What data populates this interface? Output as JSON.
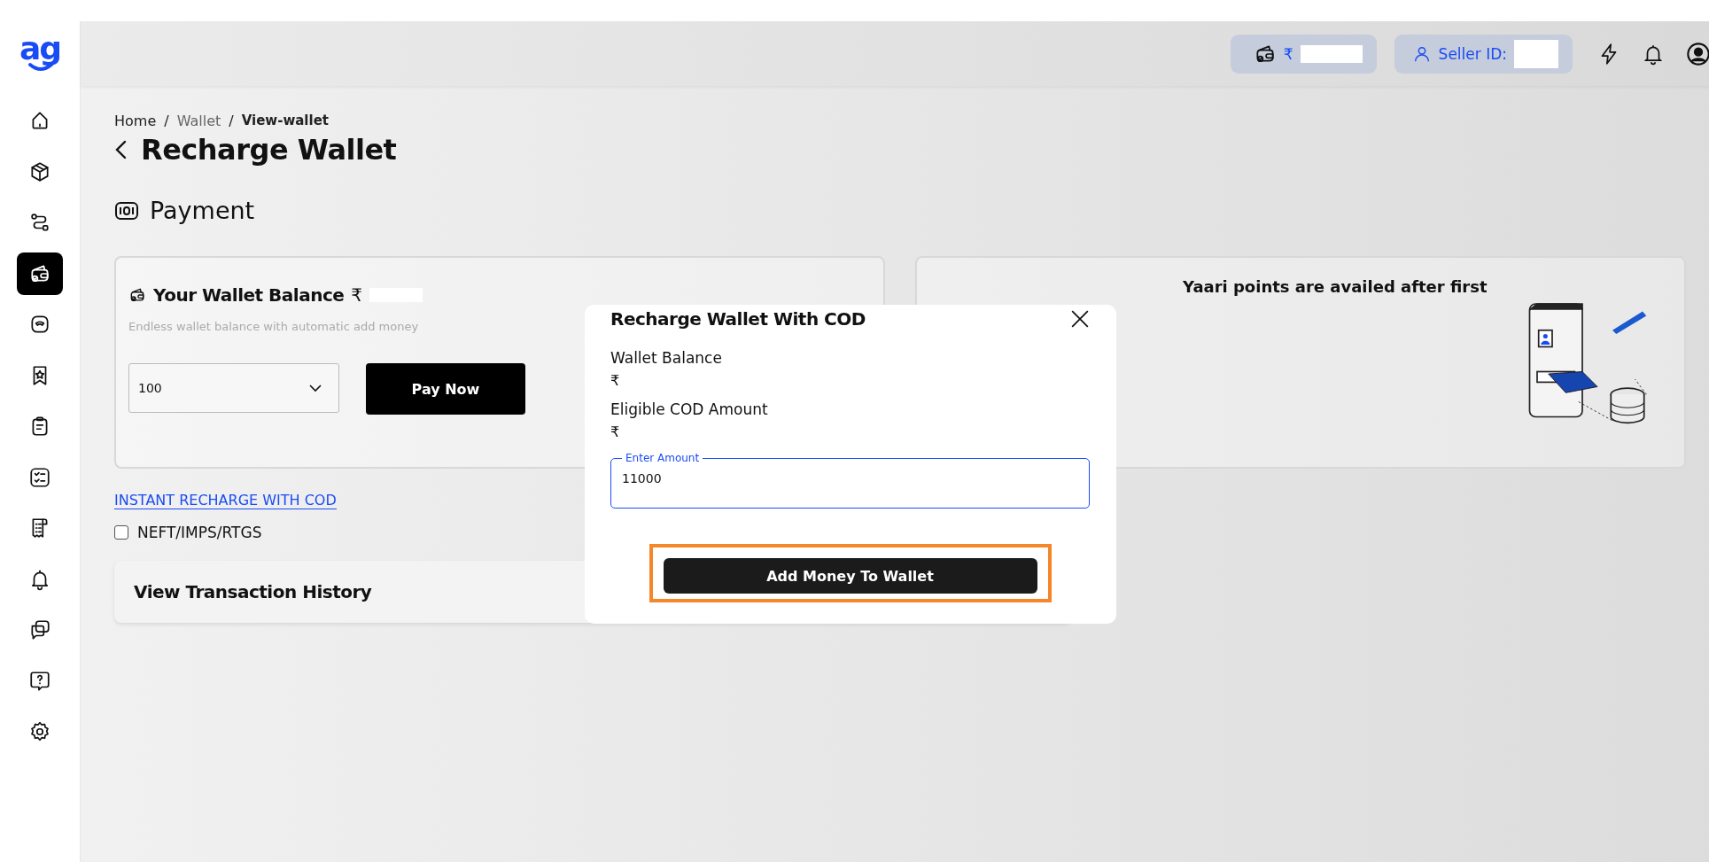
{
  "header": {
    "wallet_chip": {
      "currency": "₹"
    },
    "seller_chip": {
      "label": "Seller ID:"
    }
  },
  "sidebar": {
    "logo": "ag",
    "items": [
      {
        "kind": "home",
        "selected": false
      },
      {
        "kind": "box",
        "selected": false
      },
      {
        "kind": "route",
        "selected": false
      },
      {
        "kind": "wallet",
        "selected": true
      },
      {
        "kind": "gauge",
        "selected": false
      },
      {
        "kind": "star",
        "selected": false
      },
      {
        "kind": "clipboard",
        "selected": false
      },
      {
        "kind": "checklist",
        "selected": false
      },
      {
        "kind": "receipt",
        "selected": false
      },
      {
        "kind": "bell",
        "selected": false
      },
      {
        "kind": "chat",
        "selected": false
      },
      {
        "kind": "help",
        "selected": false
      },
      {
        "kind": "gear",
        "selected": false
      }
    ]
  },
  "breadcrumb": [
    {
      "label": "Home",
      "current": false
    },
    {
      "label": "Wallet",
      "current": false
    },
    {
      "label": "View-wallet",
      "current": true
    }
  ],
  "breadcrumb_separators": [
    "/",
    "/"
  ],
  "page_title": "Recharge Wallet",
  "section_title": "Payment",
  "wallet_card": {
    "title": "Your Wallet Balance",
    "currency": "₹",
    "subtitle": "Endless wallet balance with automatic add money",
    "amount_select": "100",
    "pay_button": "Pay Now"
  },
  "promo_card": {
    "text": "Yaari points are availed after first"
  },
  "cod_link": "INSTANT RECHARGE WITH COD",
  "bank_option": {
    "label": "NEFT/IMPS/RTGS",
    "checked": false
  },
  "history_card": {
    "title": "View Transaction History"
  },
  "modal": {
    "title": "Recharge Wallet With COD",
    "fields": [
      {
        "label": "Wallet Balance",
        "value": "₹"
      },
      {
        "label": "Eligible COD Amount",
        "value": "₹"
      }
    ],
    "amount_field": {
      "label": "Enter Amount",
      "value": "11000"
    },
    "button": {
      "label": "Add Money To Wallet",
      "highlighted": true
    }
  }
}
